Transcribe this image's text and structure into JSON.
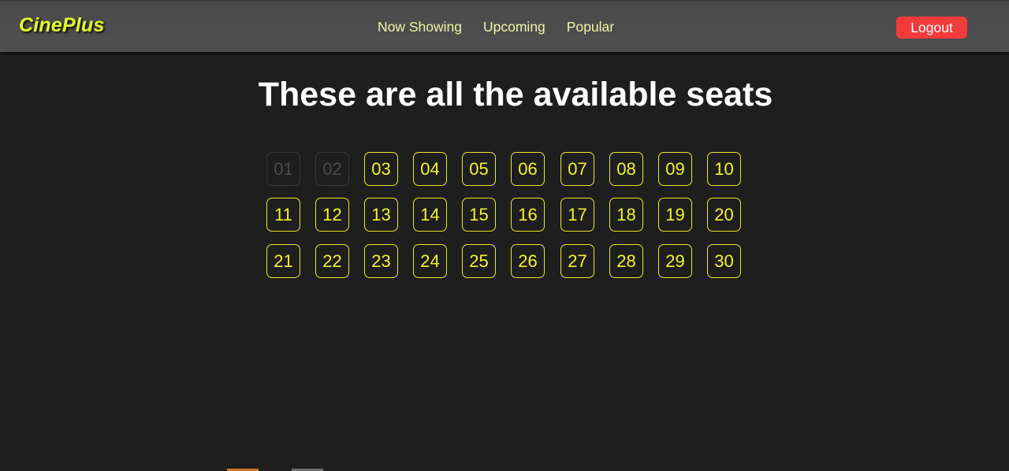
{
  "brand": "CinePlus",
  "nav": {
    "links": [
      "Now Showing",
      "Upcoming",
      "Popular"
    ],
    "logout_label": "Logout"
  },
  "page": {
    "title": "These are all the available seats"
  },
  "seats": [
    {
      "label": "01",
      "available": false
    },
    {
      "label": "02",
      "available": false
    },
    {
      "label": "03",
      "available": true
    },
    {
      "label": "04",
      "available": true
    },
    {
      "label": "05",
      "available": true
    },
    {
      "label": "06",
      "available": true
    },
    {
      "label": "07",
      "available": true
    },
    {
      "label": "08",
      "available": true
    },
    {
      "label": "09",
      "available": true
    },
    {
      "label": "10",
      "available": true
    },
    {
      "label": "11",
      "available": true
    },
    {
      "label": "12",
      "available": true
    },
    {
      "label": "13",
      "available": true
    },
    {
      "label": "14",
      "available": true
    },
    {
      "label": "15",
      "available": true
    },
    {
      "label": "16",
      "available": true
    },
    {
      "label": "17",
      "available": true
    },
    {
      "label": "18",
      "available": true
    },
    {
      "label": "19",
      "available": true
    },
    {
      "label": "20",
      "available": true
    },
    {
      "label": "21",
      "available": true
    },
    {
      "label": "22",
      "available": true
    },
    {
      "label": "23",
      "available": true
    },
    {
      "label": "24",
      "available": true
    },
    {
      "label": "25",
      "available": true
    },
    {
      "label": "26",
      "available": true
    },
    {
      "label": "27",
      "available": true
    },
    {
      "label": "28",
      "available": true
    },
    {
      "label": "29",
      "available": true
    },
    {
      "label": "30",
      "available": true
    }
  ],
  "colors": {
    "background": "#1e1e1e",
    "navbar": "#4d4d4d",
    "brand": "#e4ff2c",
    "nav_link": "#eef5a8",
    "logout": "#f23b3b",
    "seat_available": "#f3f32e",
    "seat_unavailable": "#4a4a4a"
  }
}
